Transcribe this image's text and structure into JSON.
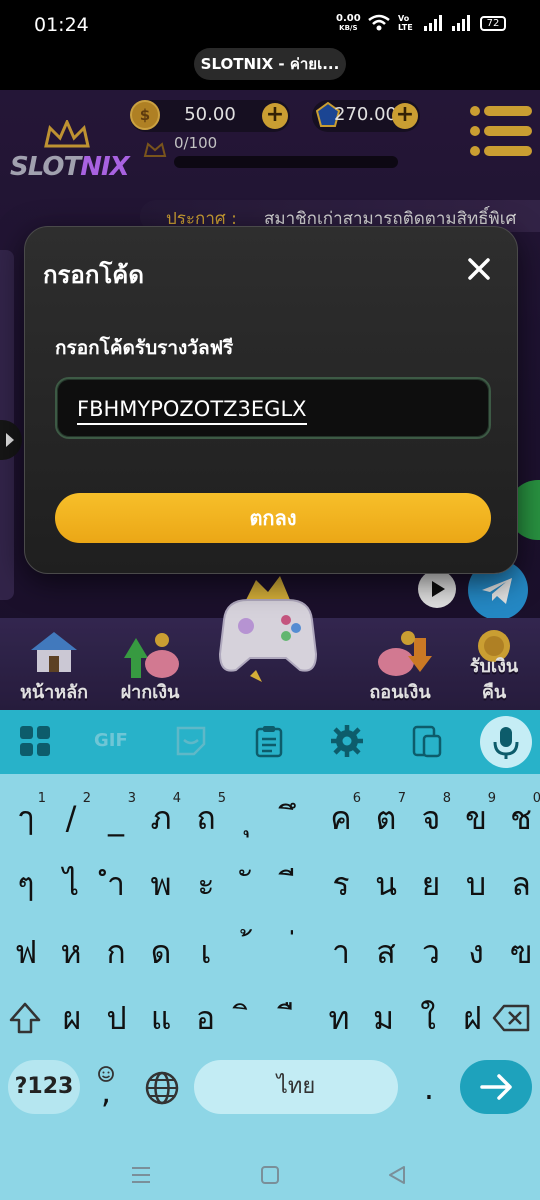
{
  "status_bar": {
    "time": "01:24",
    "net_speed_value": "0.00",
    "net_speed_unit": "KB/S",
    "volte": "Vo LTE",
    "battery": "72"
  },
  "browser": {
    "url_title": "SLOTNIX - ค่ายเ..."
  },
  "header": {
    "logo_text_a": "SLOT",
    "logo_text_b": "NIX",
    "coin_symbol": "$",
    "coin_balance": "50.00",
    "gem_balance": "270.00",
    "plus_symbol": "+",
    "level_progress": "0/100"
  },
  "announcement": {
    "label": "ประกาศ :",
    "text": "สมาชิกเก่าสามารถติดตามสิทธิ์พิเศ"
  },
  "modal": {
    "title": "กรอกโค้ด",
    "label": "กรอกโค้ดรับรางวัลฟรี",
    "code_value": "FBHMYPOZOTZ3EGLX",
    "ok_label": "ตกลง"
  },
  "bottom_nav": {
    "items": [
      {
        "label": "หน้าหลัก",
        "icon": "house-icon"
      },
      {
        "label": "ฝากเงิน",
        "icon": "piggy-deposit-icon"
      },
      {
        "label": "ถอนเงิน",
        "icon": "piggy-withdraw-icon"
      },
      {
        "label": "รับเงิน",
        "label2": "คืน",
        "icon": "cashback-icon"
      }
    ]
  },
  "keyboard": {
    "toolbar": [
      "apps-icon",
      "gif-icon",
      "sticker-icon",
      "clipboard-icon",
      "settings-icon",
      "translate-icon",
      "mic-icon"
    ],
    "gif_label": "GIF",
    "row1": [
      {
        "k": "ๅ",
        "h": "1"
      },
      {
        "k": "/",
        "h": "2"
      },
      {
        "k": "_",
        "h": "3"
      },
      {
        "k": "ภ",
        "h": "4"
      },
      {
        "k": "ถ",
        "h": "5"
      },
      {
        "k": "ุ",
        "h": ""
      },
      {
        "k": "ึ",
        "h": ""
      },
      {
        "k": "ค",
        "h": "6"
      },
      {
        "k": "ต",
        "h": "7"
      },
      {
        "k": "จ",
        "h": "8"
      },
      {
        "k": "ข",
        "h": "9"
      },
      {
        "k": "ช",
        "h": "0"
      }
    ],
    "row2": [
      "ๆ",
      "ไ",
      "ำ",
      "พ",
      "ะ",
      "ั",
      "ี",
      "ร",
      "น",
      "ย",
      "บ",
      "ล"
    ],
    "row3": [
      "ฟ",
      "ห",
      "ก",
      "ด",
      "เ",
      "้",
      "่",
      "า",
      "ส",
      "ว",
      "ง",
      "ฃ"
    ],
    "row4": [
      "ผ",
      "ป",
      "แ",
      "อ",
      "ิ",
      "ื",
      "ท",
      "ม",
      "ใ",
      "ฝ"
    ],
    "symbols_label": "?123",
    "emoji_comma": ",",
    "space_label": "ไทย",
    "period": "."
  }
}
